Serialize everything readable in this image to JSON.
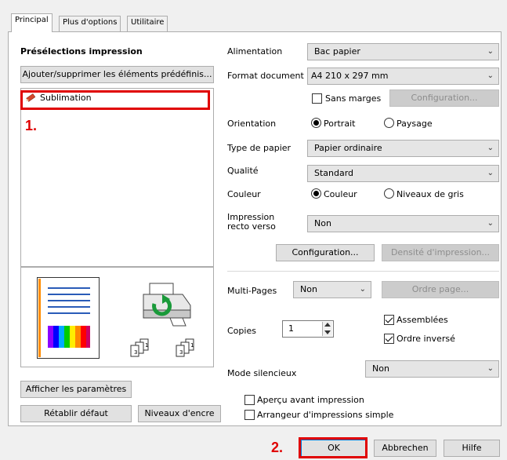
{
  "tabs": [
    {
      "label": "Principal"
    },
    {
      "label": "Plus d'options"
    },
    {
      "label": "Utilitaire"
    }
  ],
  "presets": {
    "title": "Présélections impression",
    "add_remove_button": "Ajouter/supprimer les éléments prédéfinis...",
    "selected_item": "Sublimation"
  },
  "annotations": {
    "step1": "1.",
    "step2": "2.",
    "color": "#e00000"
  },
  "left_buttons": {
    "show_settings": "Afficher les paramètres",
    "reset_default": "Rétablir défaut",
    "ink_levels": "Niveaux d'encre"
  },
  "settings": {
    "source_label": "Alimentation",
    "source_value": "Bac papier",
    "format_label": "Format document",
    "format_value": "A4 210 x 297 mm",
    "borderless_label": "Sans marges",
    "borderless_checked": false,
    "configuration_label": "Configuration...",
    "orientation_label": "Orientation",
    "portrait_label": "Portrait",
    "landscape_label": "Paysage",
    "orientation_selected": "Portrait",
    "paper_type_label": "Type de papier",
    "paper_type_value": "Papier ordinaire",
    "quality_label": "Qualité",
    "quality_value": "Standard",
    "color_label": "Couleur",
    "color_option_label": "Couleur",
    "grayscale_label": "Niveaux de gris",
    "color_selected": "Couleur",
    "duplex_label_line1": "Impression",
    "duplex_label_line2": "recto verso",
    "duplex_value": "Non",
    "duplex_configuration": "Configuration...",
    "print_density": "Densité d'impression...",
    "multipage_label": "Multi-Pages",
    "multipage_value": "Non",
    "page_order": "Ordre page...",
    "copies_label": "Copies",
    "copies_value": "1",
    "collate_label": "Assemblées",
    "collate_checked": true,
    "reverse_order_label": "Ordre inversé",
    "reverse_order_checked": true,
    "quiet_mode_label": "Mode silencieux",
    "quiet_mode_value": "Non",
    "preview_label": "Aperçu avant impression",
    "preview_checked": false,
    "simple_arranger_label": "Arrangeur d'impressions simple",
    "simple_arranger_checked": false
  },
  "dialog_buttons": {
    "ok": "OK",
    "cancel": "Abbrechen",
    "help": "Hilfe"
  }
}
